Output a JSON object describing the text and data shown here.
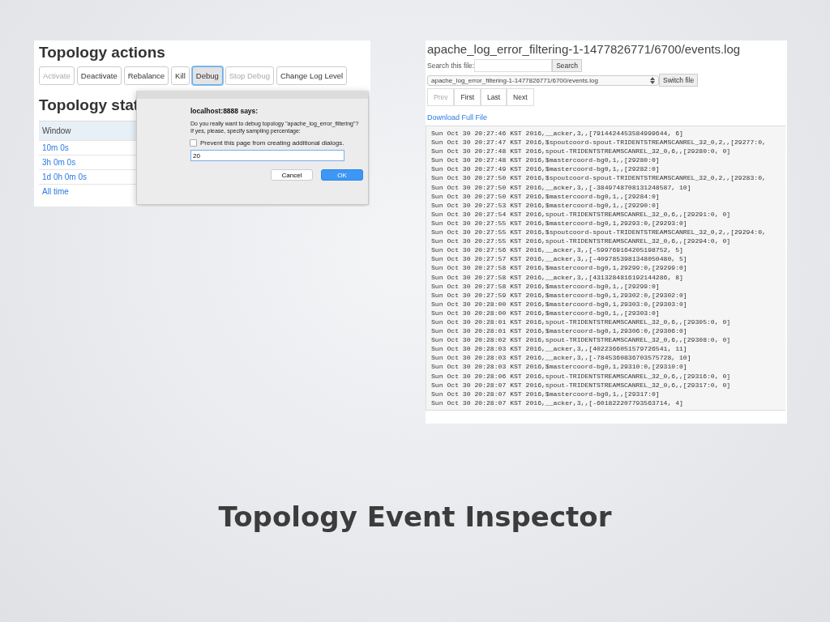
{
  "topology_panel": {
    "actions_title": "Topology actions",
    "buttons": [
      {
        "label": "Activate",
        "disabled": true,
        "selected": false
      },
      {
        "label": "Deactivate",
        "disabled": false,
        "selected": false
      },
      {
        "label": "Rebalance",
        "disabled": false,
        "selected": false
      },
      {
        "label": "Kill",
        "disabled": false,
        "selected": false
      },
      {
        "label": "Debug",
        "disabled": false,
        "selected": true
      },
      {
        "label": "Stop Debug",
        "disabled": true,
        "selected": false
      },
      {
        "label": "Change Log Level",
        "disabled": false,
        "selected": false
      }
    ],
    "stats_title": "Topology stat",
    "table": {
      "columns": [
        "Window"
      ],
      "rows": [
        "10m 0s",
        "3h 0m 0s",
        "1d 0h 0m 0s",
        "All time"
      ]
    },
    "dialog": {
      "title": "localhost:8888 says:",
      "message": "Do you really want to debug topology \"apache_log_error_filtering\"? If yes, please, specify sampling percentage:",
      "checkbox": {
        "label": "Prevent this page from creating additional dialogs.",
        "checked": false
      },
      "value": "20",
      "buttons": [
        "Cancel",
        "OK"
      ]
    }
  },
  "log_panel": {
    "title": "apache_log_error_filtering-1-1477826771/6700/events.log",
    "search_label": "Search this file:",
    "search_button": "Search",
    "file_select": "apache_log_error_filtering-1-1477826771/6700/events.log",
    "switch_button": "Switch file",
    "pager": [
      {
        "label": "Prev",
        "disabled": true
      },
      {
        "label": "First",
        "disabled": false
      },
      {
        "label": "Last",
        "disabled": false
      },
      {
        "label": "Next",
        "disabled": false
      }
    ],
    "download_link": "Download Full File",
    "lines": [
      "Sun Oct 30 20:27:46 KST 2016,__acker,3,,[7914424453584999644, 6]",
      "Sun Oct 30 20:27:47 KST 2016,$spoutcoord-spout-TRIDENTSTREAMSCANREL_32_0,2,,[29277:0,",
      "Sun Oct 30 20:27:48 KST 2016,spout-TRIDENTSTREAMSCANREL_32_0,6,,[29280:0, 0]",
      "Sun Oct 30 20:27:48 KST 2016,$mastercoord-bg0,1,,[29280:0]",
      "Sun Oct 30 20:27:49 KST 2016,$mastercoord-bg0,1,,[29282:0]",
      "Sun Oct 30 20:27:50 KST 2016,$spoutcoord-spout-TRIDENTSTREAMSCANREL_32_0,2,,[29283:0,",
      "Sun Oct 30 20:27:50 KST 2016,__acker,3,,[-3849748708131248587, 10]",
      "Sun Oct 30 20:27:50 KST 2016,$mastercoord-bg0,1,,[29284:0]",
      "Sun Oct 30 20:27:53 KST 2016,$mastercoord-bg0,1,,[29290:0]",
      "Sun Oct 30 20:27:54 KST 2016,spout-TRIDENTSTREAMSCANREL_32_0,6,,[29291:0, 0]",
      "Sun Oct 30 20:27:55 KST 2016,$mastercoord-bg0,1,29293:0,[29293:0]",
      "Sun Oct 30 20:27:55 KST 2016,$spoutcoord-spout-TRIDENTSTREAMSCANREL_32_0,2,,[29294:0,",
      "Sun Oct 30 20:27:55 KST 2016,spout-TRIDENTSTREAMSCANREL_32_0,6,,[29294:0, 0]",
      "Sun Oct 30 20:27:56 KST 2016,__acker,3,,[-599769164205198752, 5]",
      "Sun Oct 30 20:27:57 KST 2016,__acker,3,,[-4097853981348050480, 5]",
      "Sun Oct 30 20:27:58 KST 2016,$mastercoord-bg0,1,29299:0,[29299:0]",
      "Sun Oct 30 20:27:58 KST 2016,__acker,3,,[4313284816192144286, 8]",
      "Sun Oct 30 20:27:58 KST 2016,$mastercoord-bg0,1,,[29299:0]",
      "Sun Oct 30 20:27:59 KST 2016,$mastercoord-bg0,1,29302:0,[29302:0]",
      "Sun Oct 30 20:28:00 KST 2016,$mastercoord-bg0,1,29303:0,[29303:0]",
      "Sun Oct 30 20:28:00 KST 2016,$mastercoord-bg0,1,,[29303:0]",
      "Sun Oct 30 20:28:01 KST 2016,spout-TRIDENTSTREAMSCANREL_32_0,6,,[29305:0, 0]",
      "Sun Oct 30 20:28:01 KST 2016,$mastercoord-bg0,1,29306:0,[29306:0]",
      "Sun Oct 30 20:28:02 KST 2016,spout-TRIDENTSTREAMSCANREL_32_0,6,,[29308:0, 0]",
      "Sun Oct 30 20:28:03 KST 2016,__acker,3,,[4022366051579726541, 11]",
      "Sun Oct 30 20:28:03 KST 2016,__acker,3,,[-7845360836703575728, 10]",
      "Sun Oct 30 20:28:03 KST 2016,$mastercoord-bg0,1,29310:0,[29310:0]",
      "Sun Oct 30 20:28:06 KST 2016,spout-TRIDENTSTREAMSCANREL_32_0,6,,[29316:0, 0]",
      "Sun Oct 30 20:28:07 KST 2016,spout-TRIDENTSTREAMSCANREL_32_0,6,,[29317:0, 0]",
      "Sun Oct 30 20:28:07 KST 2016,$mastercoord-bg0,1,,[29317:0]",
      "Sun Oct 30 20:28:07 KST 2016,__acker,3,,[-601822207793563714, 4]"
    ]
  },
  "slide_title": "Topology Event Inspector"
}
